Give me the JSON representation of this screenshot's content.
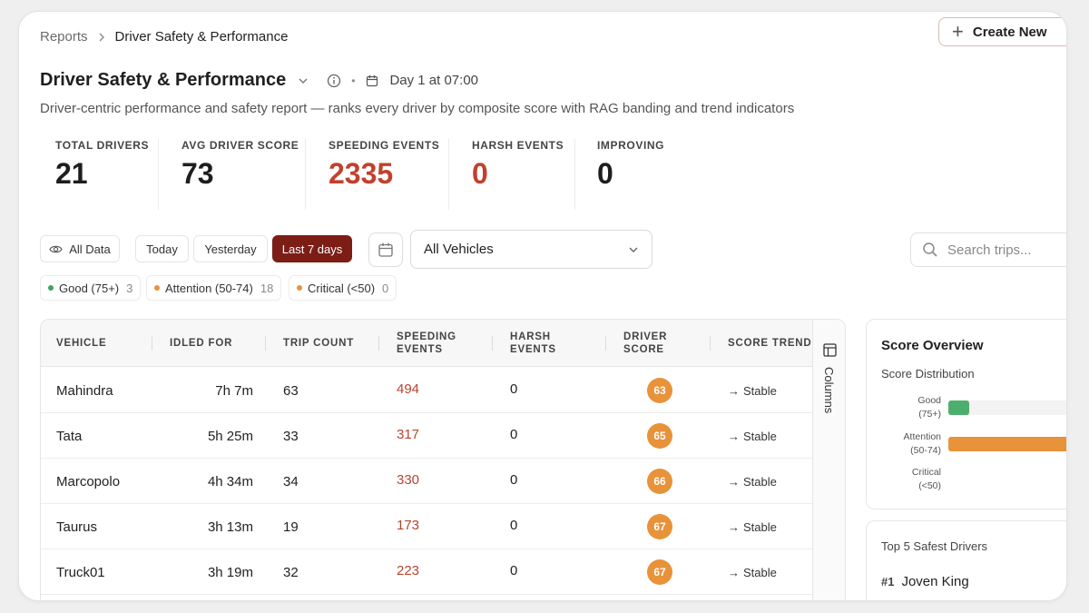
{
  "breadcrumb": {
    "parent": "Reports",
    "current": "Driver Safety & Performance"
  },
  "header": {
    "create_label": "Create New",
    "title": "Driver Safety & Performance",
    "timestamp": "Day 1 at 07:00",
    "subtitle": "Driver-centric performance and safety report — ranks every driver by composite score with RAG banding and trend indicators"
  },
  "kpis": [
    {
      "label": "TOTAL DRIVERS",
      "value": "21"
    },
    {
      "label": "AVG DRIVER SCORE",
      "value": "73"
    },
    {
      "label": "SPEEDING EVENTS",
      "value": "2335",
      "color": "#c0412f"
    },
    {
      "label": "HARSH EVENTS",
      "value": "0",
      "color": "#c0412f"
    },
    {
      "label": "IMPROVING",
      "value": "0"
    }
  ],
  "filters": {
    "all_data": "All Data",
    "ranges": [
      "Today",
      "Yesterday",
      "Last 7 days"
    ],
    "active_range": "Last 7 days",
    "vehicle_select": "All Vehicles",
    "search_placeholder": "Search trips..."
  },
  "bands": [
    {
      "label": "Good (75+)",
      "count": "3",
      "color": "#3aa55d"
    },
    {
      "label": "Attention (50-74)",
      "count": "18",
      "color": "#e8923a"
    },
    {
      "label": "Critical (<50)",
      "count": "0",
      "color": "#e8923a"
    }
  ],
  "table": {
    "headers": [
      "VEHICLE",
      "IDLED FOR",
      "TRIP COUNT",
      "SPEEDING EVENTS",
      "HARSH EVENTS",
      "DRIVER SCORE",
      "SCORE TREND"
    ],
    "rows": [
      {
        "vehicle": "Mahindra",
        "idled": "7h 7m",
        "trips": "63",
        "speeding": "494",
        "harsh": "0",
        "score": "63",
        "trend": "Stable"
      },
      {
        "vehicle": "Tata",
        "idled": "5h 25m",
        "trips": "33",
        "speeding": "317",
        "harsh": "0",
        "score": "65",
        "trend": "Stable"
      },
      {
        "vehicle": "Marcopolo",
        "idled": "4h 34m",
        "trips": "34",
        "speeding": "330",
        "harsh": "0",
        "score": "66",
        "trend": "Stable"
      },
      {
        "vehicle": "Taurus",
        "idled": "3h 13m",
        "trips": "19",
        "speeding": "173",
        "harsh": "0",
        "score": "67",
        "trend": "Stable"
      },
      {
        "vehicle": "Truck01",
        "idled": "3h 19m",
        "trips": "32",
        "speeding": "223",
        "harsh": "0",
        "score": "67",
        "trend": "Stable"
      }
    ],
    "columns_label": "Columns",
    "trend_icon": "arrow-right-icon",
    "score_color": "#e8923a"
  },
  "score_overview": {
    "title": "Score Overview",
    "subtitle": "Score Distribution",
    "bars": [
      {
        "label": "Good",
        "range": "(75+)",
        "count": 3,
        "color": "#4caf6e"
      },
      {
        "label": "Attention",
        "range": "(50-74)",
        "count": 18,
        "color": "#e8923a"
      },
      {
        "label": "Critical",
        "range": "(<50)",
        "count": 0,
        "color": "#c0412f"
      }
    ]
  },
  "safest": {
    "title": "Top 5 Safest Drivers",
    "items": [
      {
        "rank": "#1",
        "name": "Joven King"
      }
    ]
  },
  "colors": {
    "accent": "#7c1d16",
    "danger": "#c0412f",
    "warning": "#e8923a",
    "good": "#3aa55d"
  }
}
